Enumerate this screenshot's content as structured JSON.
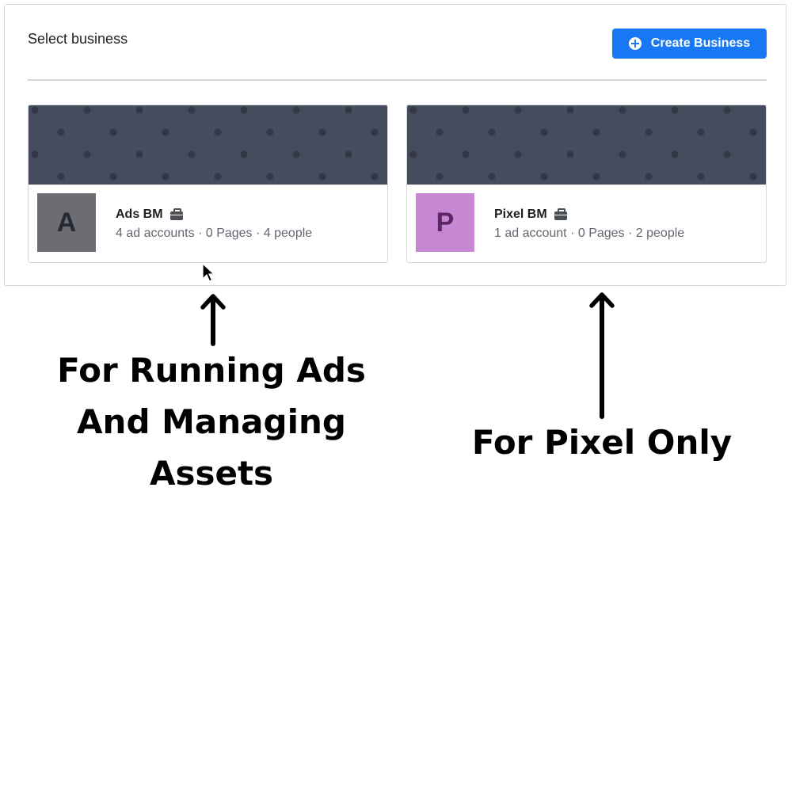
{
  "panel": {
    "title": "Select business",
    "create_button_label": "Create Business"
  },
  "businesses": [
    {
      "initial": "A",
      "name": "Ads BM",
      "stats": "4 ad accounts · 0 Pages · 4 people",
      "avatar_color": "#6c6d72"
    },
    {
      "initial": "P",
      "name": "Pixel BM",
      "stats": "1 ad account · 0 Pages · 2 people",
      "avatar_color": "#c887d2"
    }
  ],
  "annotations": {
    "left": "For Running Ads\nAnd Managing\nAssets",
    "right": "For Pixel Only"
  },
  "colors": {
    "accent": "#1877f2",
    "banner": "#454c5d"
  },
  "icons": [
    "plus-circle-icon",
    "briefcase-icon",
    "mouse-cursor-icon",
    "arrow-up-icon"
  ]
}
